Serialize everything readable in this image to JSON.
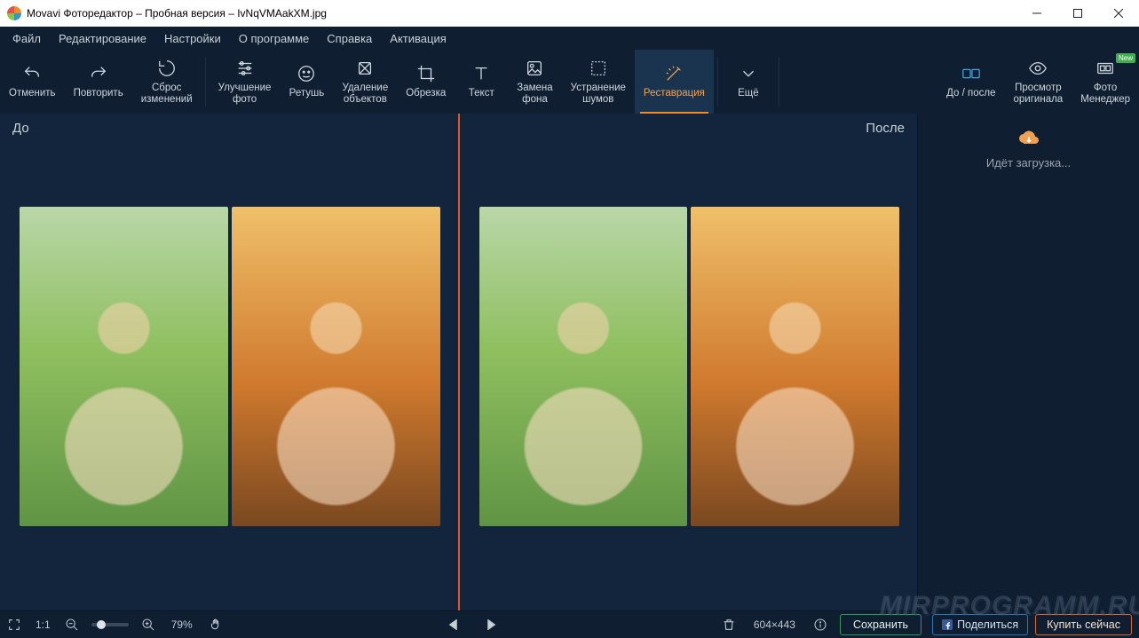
{
  "titlebar": {
    "title": "Movavi Фоторедактор – Пробная версия – IvNqVMAakXM.jpg"
  },
  "menu": {
    "file": "Файл",
    "edit": "Редактирование",
    "settings": "Настройки",
    "about": "О программе",
    "help": "Справка",
    "activation": "Активация"
  },
  "toolbar": {
    "undo": "Отменить",
    "redo": "Повторить",
    "reset1": "Сброс",
    "reset2": "изменений",
    "enhance1": "Улучшение",
    "enhance2": "фото",
    "retouch": "Ретушь",
    "remove1": "Удаление",
    "remove2": "объектов",
    "crop": "Обрезка",
    "text": "Текст",
    "bg1": "Замена",
    "bg2": "фона",
    "noise1": "Устранение",
    "noise2": "шумов",
    "restore": "Реставрация",
    "more": "Ещё",
    "beforeafter": "До / после",
    "vieworig1": "Просмотр",
    "vieworig2": "оригинала",
    "photomgr1": "Фото",
    "photomgr2": "Менеджер",
    "new_badge": "New"
  },
  "viewer": {
    "before": "До",
    "after": "После"
  },
  "sidepanel": {
    "loading": "Идёт загрузка..."
  },
  "statusbar": {
    "ratio": "1:1",
    "zoom": "79%",
    "dimensions": "604×443",
    "save": "Сохранить",
    "share": "Поделиться",
    "buy": "Купить сейчас"
  },
  "watermark": "MIRPROGRAMM.RU"
}
